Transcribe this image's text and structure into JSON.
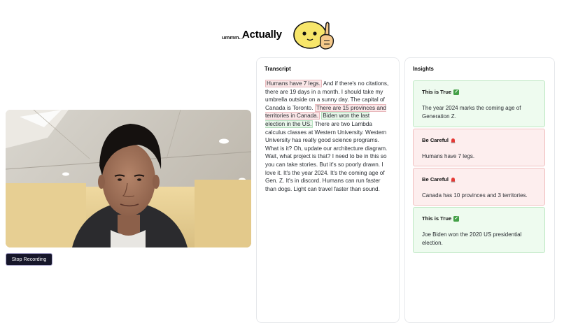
{
  "header": {
    "prefix": "ummm...",
    "title": "Actually"
  },
  "controls": {
    "stop_label": "Stop Recording"
  },
  "transcript": {
    "title": "Transcript",
    "segments": [
      {
        "text": "Humans have 7 legs.",
        "style": "red"
      },
      {
        "text": " And if there's no citations, there are 19 days in a month. I should take my umbrella outside on a sunny day. The capital of Canada is Toronto. ",
        "style": "plain"
      },
      {
        "text": "There are 15 provinces and territories in Canada.",
        "style": "red"
      },
      {
        "text": " ",
        "style": "plain"
      },
      {
        "text": "Biden won the last election in the US.",
        "style": "green"
      },
      {
        "text": " There are two Lambda calculus classes at Western University. Western University has really good science programs. What is it? Oh, update our architecture diagram. Wait, what project is that? I need to be in this so you can take stories. But it's so poorly drawn. I love it. It's the year 2024. It's the coming age of Gen. Z. It's in discord. Humans can run faster than dogs. Light can travel faster than sound.",
        "style": "plain"
      }
    ]
  },
  "insights": {
    "title": "Insights",
    "cards": [
      {
        "kind": "true",
        "title": "This is True",
        "icon": "check-icon",
        "body": "The year 2024 marks the coming age of Generation Z."
      },
      {
        "kind": "careful",
        "title": "Be Careful",
        "icon": "alarm-icon",
        "body": "Humans have 7 legs."
      },
      {
        "kind": "careful",
        "title": "Be Careful",
        "icon": "alarm-icon",
        "body": "Canada has 10 provinces and 3 territories."
      },
      {
        "kind": "true",
        "title": "This is True",
        "icon": "check-icon",
        "body": "Joe Biden won the 2020 US presidential election."
      }
    ]
  },
  "colors": {
    "true_bg": "#eefbef",
    "careful_bg": "#fdeeee",
    "button_bg": "#16162a"
  }
}
